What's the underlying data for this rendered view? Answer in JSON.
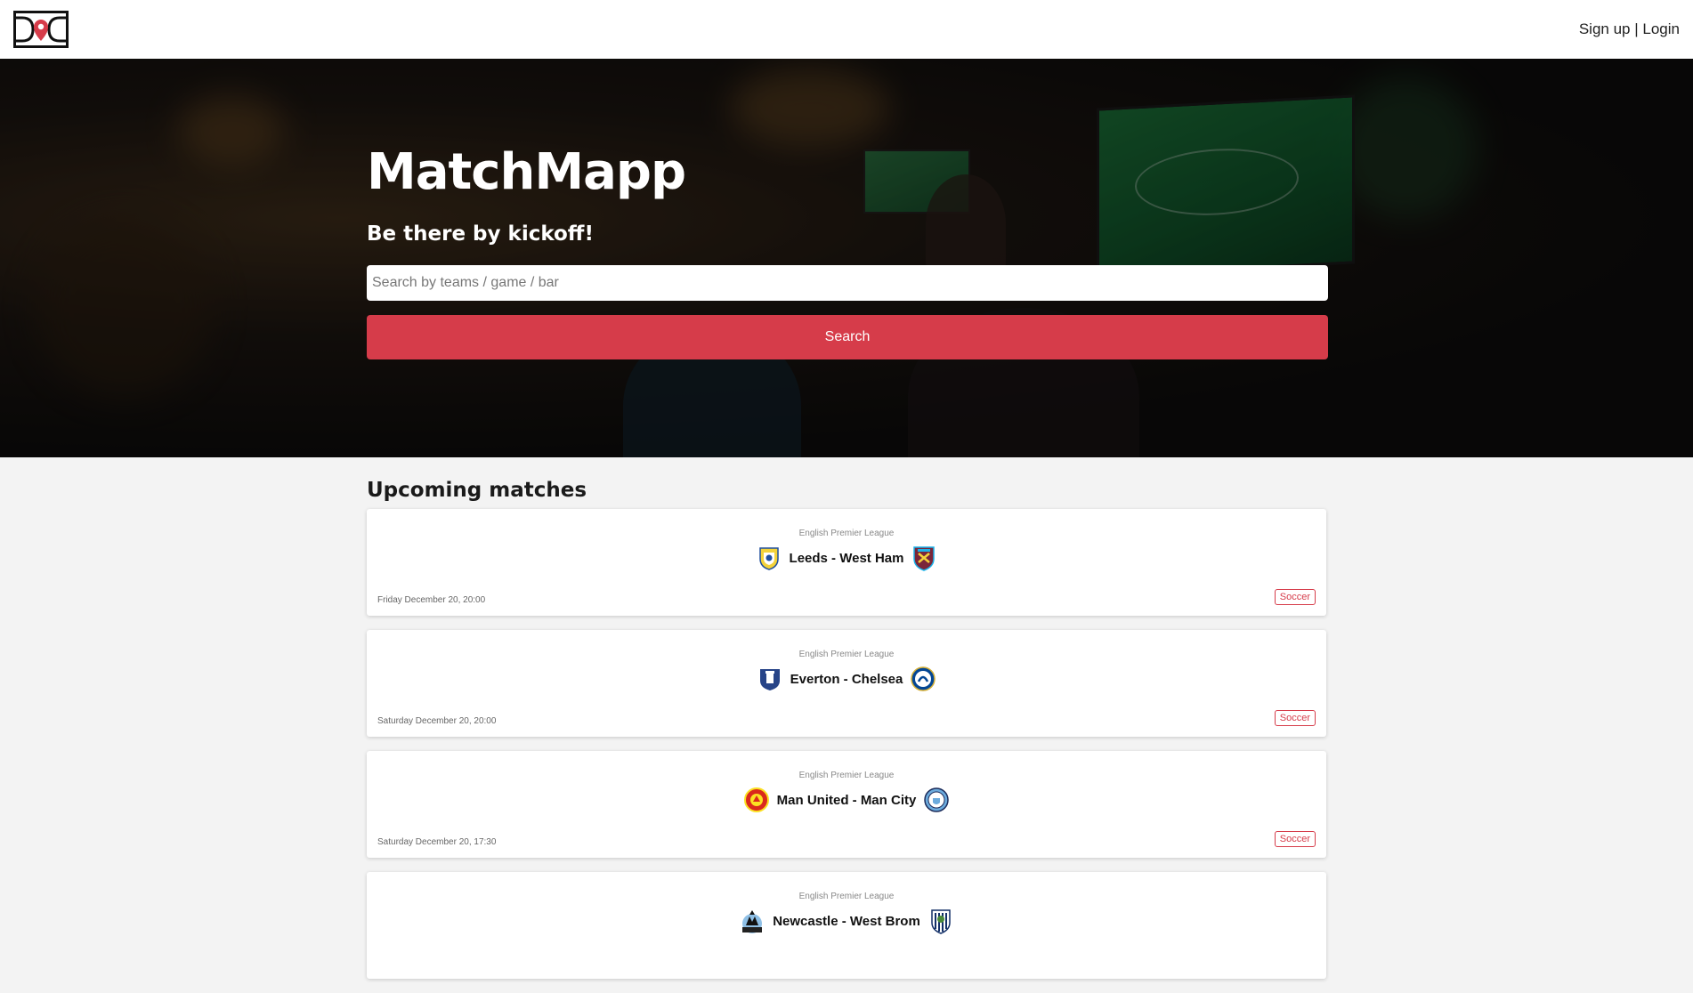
{
  "nav": {
    "logo_icon": "matchmapp-logo-icon",
    "signup_label": "Sign up",
    "separator": " | ",
    "login_label": "Login"
  },
  "hero": {
    "title": "MatchMapp",
    "tagline": "Be there by kickoff!",
    "search_placeholder": "Search by teams / game / bar",
    "search_value": "",
    "search_button_label": "Search"
  },
  "colors": {
    "accent": "#d63c4a",
    "page_bg": "#f3f3f3",
    "card_bg": "#ffffff"
  },
  "upcoming": {
    "title": "Upcoming matches",
    "matches": [
      {
        "league": "English Premier League",
        "teams": "Leeds - West Ham",
        "home_crest": "leeds-crest-icon",
        "away_crest": "west-ham-crest-icon",
        "datetime": "Friday December 20, 20:00",
        "sport": "Soccer"
      },
      {
        "league": "English Premier League",
        "teams": "Everton - Chelsea",
        "home_crest": "everton-crest-icon",
        "away_crest": "chelsea-crest-icon",
        "datetime": "Saturday December 20, 20:00",
        "sport": "Soccer"
      },
      {
        "league": "English Premier League",
        "teams": "Man United - Man City",
        "home_crest": "man-united-crest-icon",
        "away_crest": "man-city-crest-icon",
        "datetime": "Saturday December 20, 17:30",
        "sport": "Soccer"
      },
      {
        "league": "English Premier League",
        "teams": "Newcastle - West Brom",
        "home_crest": "newcastle-crest-icon",
        "away_crest": "west-brom-crest-icon",
        "datetime": "",
        "sport": ""
      }
    ]
  }
}
